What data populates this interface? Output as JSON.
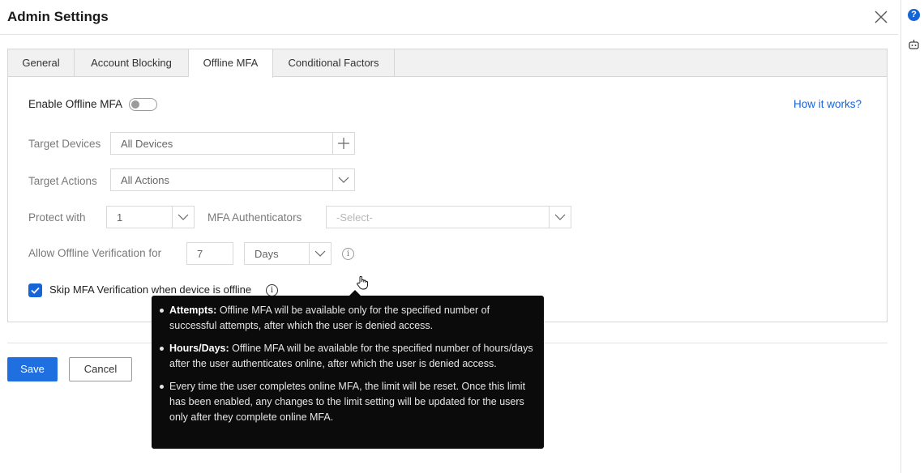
{
  "header": {
    "title": "Admin Settings"
  },
  "tabs": [
    {
      "label": "General"
    },
    {
      "label": "Account Blocking"
    },
    {
      "label": "Offline MFA"
    },
    {
      "label": "Conditional Factors"
    }
  ],
  "form": {
    "enable_label": "Enable Offline MFA",
    "how_link": "How it works?",
    "target_devices": {
      "label": "Target Devices",
      "value": "All Devices"
    },
    "target_actions": {
      "label": "Target Actions",
      "value": "All Actions"
    },
    "protect_with": {
      "label": "Protect with",
      "value": "1"
    },
    "authenticators": {
      "label": "MFA Authenticators",
      "placeholder": "-Select-"
    },
    "allow_offline": {
      "label": "Allow Offline Verification for",
      "value": "7",
      "unit": "Days"
    },
    "skip_label": "Skip MFA Verification when device is offline"
  },
  "tooltip": {
    "items": [
      {
        "title": "Attempts:",
        "text": " Offline MFA will be available only for the specified number of successful attempts, after which the user is denied access."
      },
      {
        "title": "Hours/Days:",
        "text": " Offline MFA will be available for the specified number of hours/days after the user authenticates online, after which the user is denied access."
      },
      {
        "title": "",
        "text": "Every time the user completes online MFA, the limit will be reset. Once this limit has been enabled, any changes to the limit setting will be updated for the users only after they complete online MFA."
      }
    ]
  },
  "actions": {
    "save": "Save",
    "cancel": "Cancel"
  },
  "rail": {
    "help_glyph": "?"
  },
  "info_glyph": "i",
  "colors": {
    "accent": "#1565d8",
    "tooltip_bg": "#0b0b0b"
  },
  "icons": [
    "close-icon",
    "help-icon",
    "bot-icon",
    "plus-icon",
    "chevron-down-icon",
    "info-icon",
    "check-icon",
    "hand-cursor-icon"
  ]
}
